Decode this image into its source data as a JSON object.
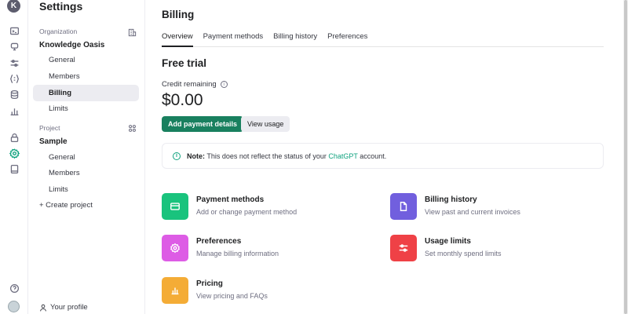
{
  "rail": {
    "avatar_letter": "K",
    "icons": [
      "terminal-icon",
      "assistant-icon",
      "sliders-icon",
      "braces-icon",
      "database-icon",
      "bar-chart-icon",
      "lock-icon",
      "gear-icon",
      "book-icon",
      "help-icon"
    ]
  },
  "sidebar": {
    "title": "Settings",
    "org_section": "Organization",
    "org_name": "Knowledge Oasis",
    "org_items": [
      {
        "label": "General"
      },
      {
        "label": "Members"
      },
      {
        "label": "Billing"
      },
      {
        "label": "Limits"
      }
    ],
    "project_section": "Project",
    "project_name": "Sample",
    "project_items": [
      {
        "label": "General"
      },
      {
        "label": "Members"
      },
      {
        "label": "Limits"
      }
    ],
    "create_project": "+ Create project",
    "profile": "Your profile"
  },
  "main": {
    "title": "Billing",
    "tabs": [
      {
        "label": "Overview"
      },
      {
        "label": "Payment methods"
      },
      {
        "label": "Billing history"
      },
      {
        "label": "Preferences"
      }
    ],
    "trial_heading": "Free trial",
    "credit_label": "Credit remaining",
    "credit_amount": "$0.00",
    "add_payment_label": "Add payment details",
    "view_usage_label": "View usage",
    "note": {
      "prefix": "Note:",
      "text": " This does not reflect the status of your ",
      "link": "ChatGPT",
      "suffix": " account."
    },
    "cards": [
      {
        "title": "Payment methods",
        "desc": "Add or change payment method",
        "color": "#19c37d"
      },
      {
        "title": "Billing history",
        "desc": "View past and current invoices",
        "color": "#715fde"
      },
      {
        "title": "Preferences",
        "desc": "Manage billing information",
        "color": "#dd5ce5"
      },
      {
        "title": "Usage limits",
        "desc": "Set monthly spend limits",
        "color": "#ef4146"
      },
      {
        "title": "Pricing",
        "desc": "View pricing and FAQs",
        "color": "#f4ac36"
      }
    ]
  },
  "colors": {
    "accent": "#10a37f",
    "primary_button": "#19805f"
  }
}
